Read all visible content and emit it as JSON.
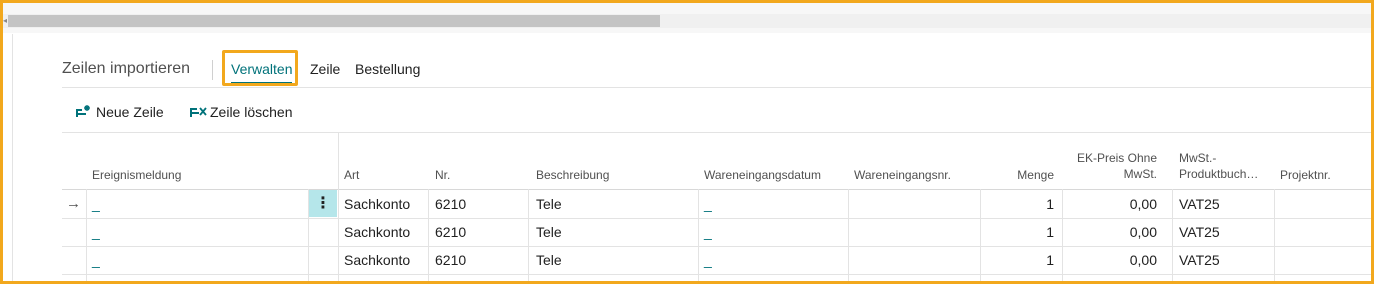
{
  "page": {
    "title": "Zeilen importieren",
    "tabs": [
      {
        "label": "Verwalten",
        "active": true
      },
      {
        "label": "Zeile",
        "active": false
      },
      {
        "label": "Bestellung",
        "active": false
      }
    ]
  },
  "actions": {
    "new_line": {
      "label": "Neue Zeile",
      "icon": "new-line-icon"
    },
    "delete_line": {
      "label": "Zeile löschen",
      "icon": "delete-line-icon"
    }
  },
  "grid": {
    "columns": {
      "ereignismeldung": "Ereignismeldung",
      "art": "Art",
      "nr": "Nr.",
      "beschreibung": "Beschreibung",
      "wareneingangsdatum": "Wareneingangsdatum",
      "wareneingangsnr": "Wareneingangsnr.",
      "menge": "Menge",
      "ek_preis_l1": "EK-Preis Ohne",
      "ek_preis_l2": "MwSt.",
      "mwst_l1": "MwSt.-",
      "mwst_l2": "Produktbuch…",
      "projektnr": "Projektnr."
    },
    "rows": [
      {
        "ereignismeldung": "_",
        "art": "Sachkonto",
        "nr": "6210",
        "beschreibung": "Tele",
        "wareneingangsdatum": "_",
        "wareneingangsnr": "",
        "menge": "1",
        "ek_preis": "0,00",
        "mwst": "VAT25",
        "projektnr": ""
      },
      {
        "ereignismeldung": "_",
        "art": "Sachkonto",
        "nr": "6210",
        "beschreibung": "Tele",
        "wareneingangsdatum": "_",
        "wareneingangsnr": "",
        "menge": "1",
        "ek_preis": "0,00",
        "mwst": "VAT25",
        "projektnr": ""
      },
      {
        "ereignismeldung": "_",
        "art": "Sachkonto",
        "nr": "6210",
        "beschreibung": "Tele",
        "wareneingangsdatum": "_",
        "wareneingangsnr": "",
        "menge": "1",
        "ek_preis": "0,00",
        "mwst": "VAT25",
        "projektnr": ""
      }
    ],
    "current_row_marker": "→",
    "row_menu_glyph": "⋮"
  },
  "colors": {
    "accent": "#00727a",
    "highlight_frame": "#f2a81d",
    "selected_cell": "#b5e6ea"
  }
}
